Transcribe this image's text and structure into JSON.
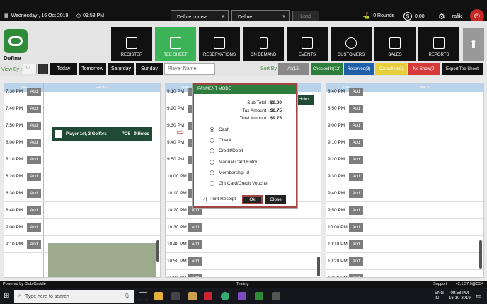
{
  "topbar": {
    "date": "Wednesday ,  16 Oct 2019",
    "time": "09:58 PM",
    "course_select": "Define course",
    "define_select": "Define",
    "load": "Load",
    "rounds": "0 Rounds",
    "amount": "0.00",
    "user": "rafik"
  },
  "brand": {
    "name": "Define"
  },
  "nav": [
    {
      "label": "REGISTER"
    },
    {
      "label": "TEE SHEET"
    },
    {
      "label": "RESERVATIONS"
    },
    {
      "label": "ON DEMAND"
    },
    {
      "label": "EVENTS"
    },
    {
      "label": "CUSTOMERS"
    },
    {
      "label": "SALES"
    },
    {
      "label": "REPORTS"
    }
  ],
  "filter": {
    "view_by": "View By :",
    "date_placeholder": "17",
    "today": "Today",
    "tomorrow": "Tomorrow",
    "saturday": "Saturday",
    "sunday": "Sunday",
    "player_name_placeholder": "Player Name",
    "sort_by": "Sort By",
    "all": "All(15)",
    "checkedin": "CheckedIn(12)",
    "reserved": "Reserved(3)",
    "cancelled": "Cancelled(0)",
    "noshow": "No Show(0)",
    "export": "Export Tee Sheet"
  },
  "grid1": {
    "time_header": "TIME",
    "col_header": "FRONT",
    "times": [
      "7:30 PM",
      "7:40 PM",
      "7:50 PM",
      "8:00 PM",
      "8:10 PM",
      "8:20 PM",
      "8:30 PM",
      "8:40 PM",
      "9:00 PM",
      "9:10 PM"
    ],
    "booking": {
      "name": "Player 1st, 3 Golfers",
      "pos": "POS",
      "holes": "9 Holes"
    }
  },
  "grid2": {
    "time_header": "TIME",
    "times": [
      "9:10 PM",
      "9:20 PM",
      "9:30 PM",
      "9:40 PM",
      "9:50 PM",
      "10:00 PM",
      "10:10 PM",
      "10:20 PM",
      "10:30 PM",
      "10:40 PM",
      "10:50 PM",
      "11:00 PM"
    ],
    "holes_tag": "Holes"
  },
  "grid3": {
    "time_header": "TIME",
    "col_header": "BACK",
    "times": [
      "8:40 PM",
      "8:50 PM",
      "9:00 PM",
      "9:10 PM",
      "9:20 PM",
      "9:30 PM",
      "9:40 PM",
      "9:50 PM",
      "10:00 PM",
      "10:10 PM",
      "10:20 PM",
      "10:30 PM",
      "10:40 PM"
    ]
  },
  "add_label": "Add",
  "modal": {
    "title": "PAYMENT MODE",
    "sub_total_label": "Sub Total :",
    "sub_total": "$9.00",
    "tax_label": "Tax Amount :",
    "tax": "$0.75",
    "total_label": "Total Amount :",
    "total": "$9.75",
    "options": [
      "Cash",
      "Check",
      "Credit/Debit",
      "Manual Card Entry",
      "Membership Id",
      "Gift Card/Credit Voucher"
    ],
    "selected": "Cash",
    "print_receipt": "Print Receipt",
    "ok": "Ok",
    "close": "Close"
  },
  "footer": {
    "left": "Powered by Club Caddie",
    "center": "Testing",
    "support": "Support",
    "version": "v2.1.37.0@CC4"
  },
  "taskbar": {
    "search": "Type here to search",
    "lang1": "ENG",
    "lang2": "IN",
    "time": "09:58 PM",
    "date": "16-10-2019"
  }
}
